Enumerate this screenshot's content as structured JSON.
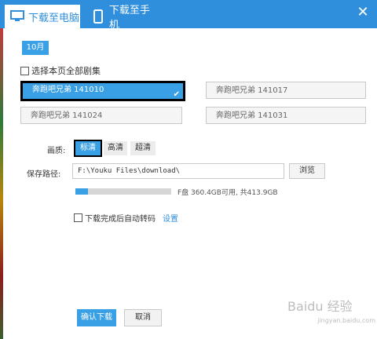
{
  "tabs": {
    "computer": "下载至电脑",
    "phone": "下载至手机"
  },
  "month": "10月",
  "select_all": "选择本页全部剧集",
  "episodes": [
    {
      "label": "奔跑吧兄弟 141010",
      "selected": true
    },
    {
      "label": "奔跑吧兄弟 141017",
      "selected": false
    },
    {
      "label": "奔跑吧兄弟 141024",
      "selected": false
    },
    {
      "label": "奔跑吧兄弟 141031",
      "selected": false
    }
  ],
  "quality": {
    "label": "画质:",
    "options": [
      "标清",
      "高清",
      "超清"
    ],
    "selected": "标清"
  },
  "save_path": {
    "label": "保存路径:",
    "value": "F:\\Youku Files\\download\\",
    "browse": "浏览"
  },
  "disk": {
    "info": "F盘 360.4GB可用, 共413.9GB",
    "used_fraction": 0.13
  },
  "auto_transcode": {
    "label": "下载完成后自动转码",
    "link": "设置"
  },
  "buttons": {
    "confirm": "确认下载",
    "cancel": "取消"
  },
  "watermark": {
    "main": "Baidu 经验",
    "sub": "jingyan.baidu.com"
  },
  "colors": {
    "accent": "#2f8fdc",
    "button_blue": "#3aa0e6"
  }
}
